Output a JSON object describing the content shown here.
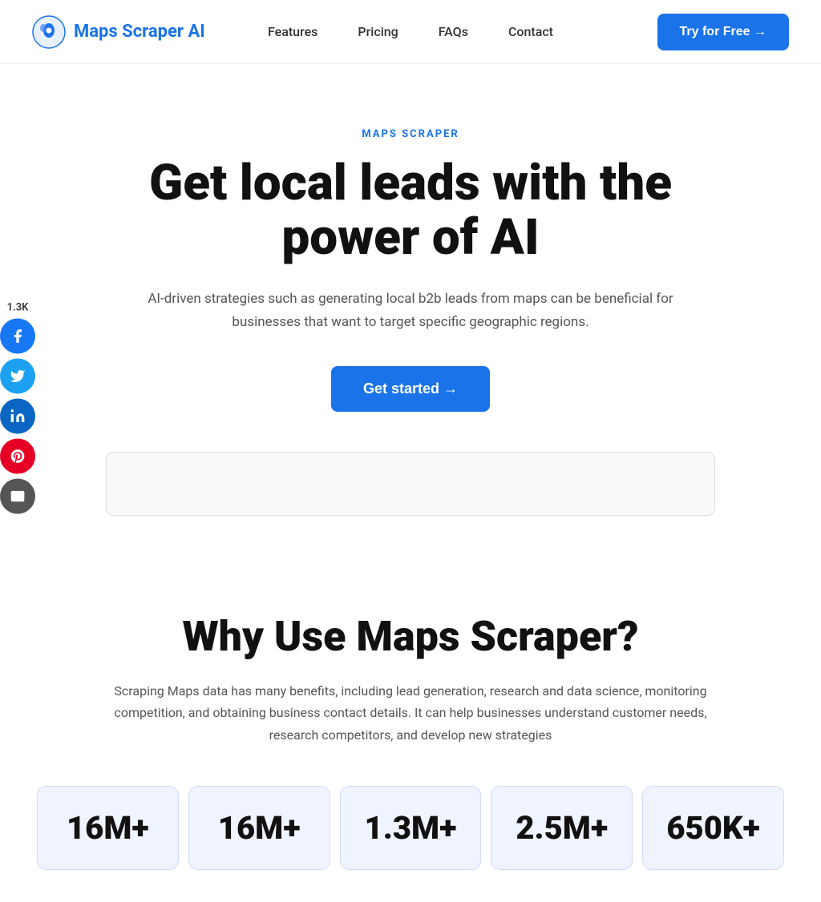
{
  "nav": {
    "logo_text": "Maps Scraper AI",
    "links": [
      {
        "label": "Features",
        "href": "#"
      },
      {
        "label": "Pricing",
        "href": "#"
      },
      {
        "label": "FAQs",
        "href": "#"
      },
      {
        "label": "Contact",
        "href": "#"
      }
    ],
    "cta_label": "Try for Free →"
  },
  "social": {
    "count": "1.3K",
    "platforms": [
      {
        "name": "Facebook",
        "class": "social-facebook"
      },
      {
        "name": "Twitter",
        "class": "social-twitter"
      },
      {
        "name": "LinkedIn",
        "class": "social-linkedin"
      },
      {
        "name": "Pinterest",
        "class": "social-pinterest"
      },
      {
        "name": "Email",
        "class": "social-email"
      }
    ]
  },
  "hero": {
    "tag": "MAPS SCRAPER",
    "title": "Get local leads with the power of AI",
    "subtitle": "AI-driven strategies such as generating local b2b leads from maps can be beneficial for businesses that want to target specific geographic regions.",
    "cta_label": "Get started →"
  },
  "why": {
    "title": "Why Use Maps Scraper?",
    "desc": "Scraping Maps data has many benefits, including lead generation, research and data science, monitoring competition, and obtaining business contact details. It can help businesses understand customer needs, research competitors, and develop new strategies"
  },
  "stats": [
    {
      "number": "16M+"
    },
    {
      "number": "16M+"
    },
    {
      "number": "1.3M+"
    },
    {
      "number": "2.5M+"
    },
    {
      "number": "650K+"
    }
  ]
}
